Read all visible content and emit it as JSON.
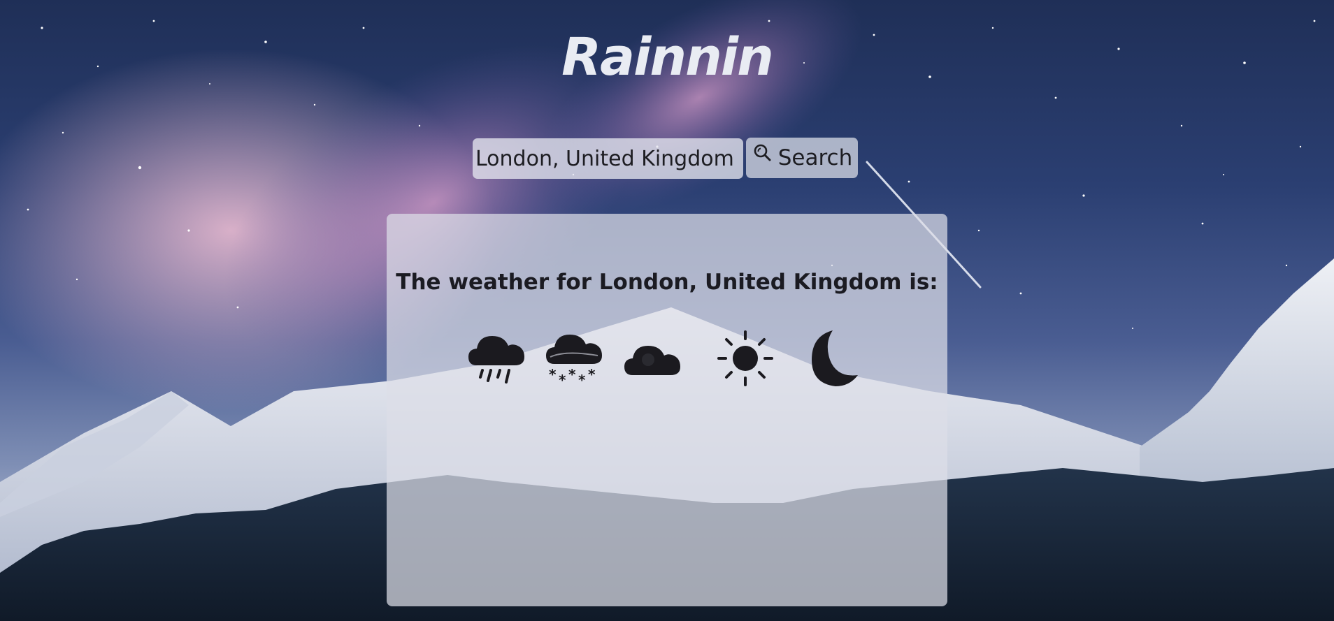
{
  "app": {
    "title": "Rainnin"
  },
  "search": {
    "value": "London, United Kingdom",
    "button_label": "Search",
    "button_icon": "search-icon"
  },
  "weather": {
    "heading": "The weather for London, United Kingdom is:",
    "icons": [
      "rain-cloud-icon",
      "snow-cloud-icon",
      "cloud-icon",
      "sun-icon",
      "moon-icon"
    ]
  },
  "colors": {
    "title": "#e9ecf3",
    "card_background": "#dcdee8",
    "text": "#1b1b22",
    "icon": "#1b1a1f"
  }
}
